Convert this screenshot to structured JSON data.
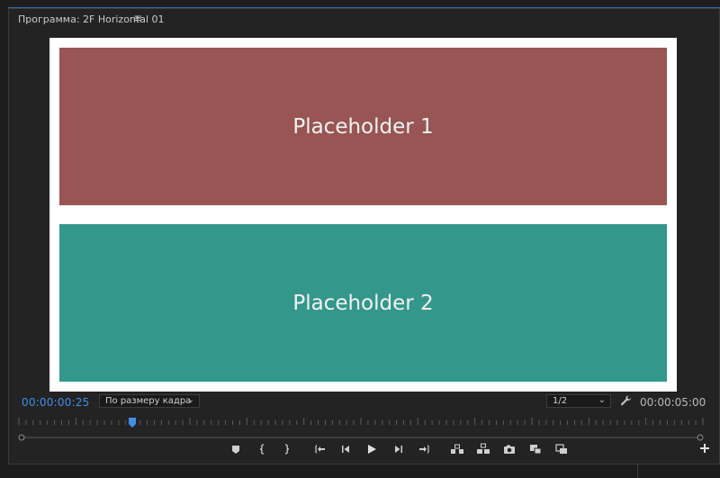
{
  "panel": {
    "title": "Программа: 2F Horizontal 01",
    "menu_icon": "hamburger-menu-icon"
  },
  "monitor": {
    "background": "#ffffff",
    "placeholders": [
      {
        "label": "Placeholder 1",
        "color": "#985553"
      },
      {
        "label": "Placeholder 2",
        "color": "#33978b"
      }
    ]
  },
  "transport": {
    "current_timecode": "00:00:00:25",
    "zoom_select": "По размеру кадра",
    "resolution_select": "1/2",
    "settings_icon": "wrench-icon",
    "duration_timecode": "00:00:05:00",
    "playhead_fraction": 0.167
  },
  "controls": {
    "buttons": [
      "add-marker-icon",
      "mark-in-icon",
      "mark-out-icon",
      "go-to-in-icon",
      "step-back-icon",
      "play-icon",
      "step-forward-icon",
      "go-to-out-icon",
      "lift-icon",
      "extract-icon",
      "export-frame-icon",
      "insert-icon",
      "overwrite-icon"
    ],
    "add_button_icon": "plus-icon"
  },
  "colors": {
    "accent": "#3f8ee6",
    "panel_bg": "#232323"
  }
}
